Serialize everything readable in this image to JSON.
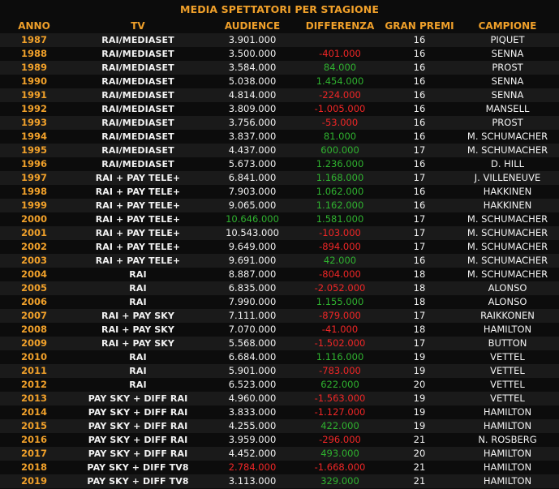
{
  "title": "MEDIA SPETTATORI PER STAGIONE",
  "colors": {
    "header": "#f0a02a",
    "year": "#f0a02a",
    "text": "#f2f2f2",
    "positive": "#2fb22f",
    "negative": "#f02626"
  },
  "chart_data": {
    "type": "table",
    "title": "MEDIA SPETTATORI PER STAGIONE",
    "columns": [
      "ANNO",
      "TV",
      "AUDIENCE",
      "DIFFERENZA",
      "GRAN PREMI",
      "CAMPIONE"
    ],
    "rows": [
      {
        "year": "1987",
        "tv": "RAI/MEDIASET",
        "audience": "3.901.000",
        "diff": "",
        "diff_sign": "none",
        "gp": "16",
        "champion": "PIQUET",
        "aud_color": "white"
      },
      {
        "year": "1988",
        "tv": "RAI/MEDIASET",
        "audience": "3.500.000",
        "diff": "-401.000",
        "diff_sign": "neg",
        "gp": "16",
        "champion": "SENNA",
        "aud_color": "white"
      },
      {
        "year": "1989",
        "tv": "RAI/MEDIASET",
        "audience": "3.584.000",
        "diff": "84.000",
        "diff_sign": "pos",
        "gp": "16",
        "champion": "PROST",
        "aud_color": "white"
      },
      {
        "year": "1990",
        "tv": "RAI/MEDIASET",
        "audience": "5.038.000",
        "diff": "1.454.000",
        "diff_sign": "pos",
        "gp": "16",
        "champion": "SENNA",
        "aud_color": "white"
      },
      {
        "year": "1991",
        "tv": "RAI/MEDIASET",
        "audience": "4.814.000",
        "diff": "-224.000",
        "diff_sign": "neg",
        "gp": "16",
        "champion": "SENNA",
        "aud_color": "white"
      },
      {
        "year": "1992",
        "tv": "RAI/MEDIASET",
        "audience": "3.809.000",
        "diff": "-1.005.000",
        "diff_sign": "neg",
        "gp": "16",
        "champion": "MANSELL",
        "aud_color": "white"
      },
      {
        "year": "1993",
        "tv": "RAI/MEDIASET",
        "audience": "3.756.000",
        "diff": "-53.000",
        "diff_sign": "neg",
        "gp": "16",
        "champion": "PROST",
        "aud_color": "white"
      },
      {
        "year": "1994",
        "tv": "RAI/MEDIASET",
        "audience": "3.837.000",
        "diff": "81.000",
        "diff_sign": "pos",
        "gp": "16",
        "champion": "M. SCHUMACHER",
        "aud_color": "white"
      },
      {
        "year": "1995",
        "tv": "RAI/MEDIASET",
        "audience": "4.437.000",
        "diff": "600.000",
        "diff_sign": "pos",
        "gp": "17",
        "champion": "M. SCHUMACHER",
        "aud_color": "white"
      },
      {
        "year": "1996",
        "tv": "RAI/MEDIASET",
        "audience": "5.673.000",
        "diff": "1.236.000",
        "diff_sign": "pos",
        "gp": "16",
        "champion": "D. HILL",
        "aud_color": "white"
      },
      {
        "year": "1997",
        "tv": "RAI + PAY TELE+",
        "audience": "6.841.000",
        "diff": "1.168.000",
        "diff_sign": "pos",
        "gp": "17",
        "champion": "J. VILLENEUVE",
        "aud_color": "white"
      },
      {
        "year": "1998",
        "tv": "RAI + PAY TELE+",
        "audience": "7.903.000",
        "diff": "1.062.000",
        "diff_sign": "pos",
        "gp": "16",
        "champion": "HAKKINEN",
        "aud_color": "white"
      },
      {
        "year": "1999",
        "tv": "RAI + PAY TELE+",
        "audience": "9.065.000",
        "diff": "1.162.000",
        "diff_sign": "pos",
        "gp": "16",
        "champion": "HAKKINEN",
        "aud_color": "white"
      },
      {
        "year": "2000",
        "tv": "RAI + PAY TELE+",
        "audience": "10.646.000",
        "diff": "1.581.000",
        "diff_sign": "pos",
        "gp": "17",
        "champion": "M. SCHUMACHER",
        "aud_color": "green"
      },
      {
        "year": "2001",
        "tv": "RAI + PAY TELE+",
        "audience": "10.543.000",
        "diff": "-103.000",
        "diff_sign": "neg",
        "gp": "17",
        "champion": "M. SCHUMACHER",
        "aud_color": "white"
      },
      {
        "year": "2002",
        "tv": "RAI + PAY TELE+",
        "audience": "9.649.000",
        "diff": "-894.000",
        "diff_sign": "neg",
        "gp": "17",
        "champion": "M. SCHUMACHER",
        "aud_color": "white"
      },
      {
        "year": "2003",
        "tv": "RAI + PAY TELE+",
        "audience": "9.691.000",
        "diff": "42.000",
        "diff_sign": "pos",
        "gp": "16",
        "champion": "M. SCHUMACHER",
        "aud_color": "white"
      },
      {
        "year": "2004",
        "tv": "RAI",
        "audience": "8.887.000",
        "diff": "-804.000",
        "diff_sign": "neg",
        "gp": "18",
        "champion": "M. SCHUMACHER",
        "aud_color": "white"
      },
      {
        "year": "2005",
        "tv": "RAI",
        "audience": "6.835.000",
        "diff": "-2.052.000",
        "diff_sign": "neg",
        "gp": "18",
        "champion": "ALONSO",
        "aud_color": "white"
      },
      {
        "year": "2006",
        "tv": "RAI",
        "audience": "7.990.000",
        "diff": "1.155.000",
        "diff_sign": "pos",
        "gp": "18",
        "champion": "ALONSO",
        "aud_color": "white"
      },
      {
        "year": "2007",
        "tv": "RAI + PAY SKY",
        "audience": "7.111.000",
        "diff": "-879.000",
        "diff_sign": "neg",
        "gp": "17",
        "champion": "RAIKKONEN",
        "aud_color": "white"
      },
      {
        "year": "2008",
        "tv": "RAI + PAY SKY",
        "audience": "7.070.000",
        "diff": "-41.000",
        "diff_sign": "neg",
        "gp": "18",
        "champion": "HAMILTON",
        "aud_color": "white"
      },
      {
        "year": "2009",
        "tv": "RAI + PAY SKY",
        "audience": "5.568.000",
        "diff": "-1.502.000",
        "diff_sign": "neg",
        "gp": "17",
        "champion": "BUTTON",
        "aud_color": "white"
      },
      {
        "year": "2010",
        "tv": "RAI",
        "audience": "6.684.000",
        "diff": "1.116.000",
        "diff_sign": "pos",
        "gp": "19",
        "champion": "VETTEL",
        "aud_color": "white"
      },
      {
        "year": "2011",
        "tv": "RAI",
        "audience": "5.901.000",
        "diff": "-783.000",
        "diff_sign": "neg",
        "gp": "19",
        "champion": "VETTEL",
        "aud_color": "white"
      },
      {
        "year": "2012",
        "tv": "RAI",
        "audience": "6.523.000",
        "diff": "622.000",
        "diff_sign": "pos",
        "gp": "20",
        "champion": "VETTEL",
        "aud_color": "white"
      },
      {
        "year": "2013",
        "tv": "PAY SKY + DIFF RAI",
        "audience": "4.960.000",
        "diff": "-1.563.000",
        "diff_sign": "neg",
        "gp": "19",
        "champion": "VETTEL",
        "aud_color": "white"
      },
      {
        "year": "2014",
        "tv": "PAY SKY + DIFF RAI",
        "audience": "3.833.000",
        "diff": "-1.127.000",
        "diff_sign": "neg",
        "gp": "19",
        "champion": "HAMILTON",
        "aud_color": "white"
      },
      {
        "year": "2015",
        "tv": "PAY SKY + DIFF RAI",
        "audience": "4.255.000",
        "diff": "422.000",
        "diff_sign": "pos",
        "gp": "19",
        "champion": "HAMILTON",
        "aud_color": "white"
      },
      {
        "year": "2016",
        "tv": "PAY SKY + DIFF RAI",
        "audience": "3.959.000",
        "diff": "-296.000",
        "diff_sign": "neg",
        "gp": "21",
        "champion": "N. ROSBERG",
        "aud_color": "white"
      },
      {
        "year": "2017",
        "tv": "PAY SKY + DIFF RAI",
        "audience": "4.452.000",
        "diff": "493.000",
        "diff_sign": "pos",
        "gp": "20",
        "champion": "HAMILTON",
        "aud_color": "white"
      },
      {
        "year": "2018",
        "tv": "PAY SKY + DIFF TV8",
        "audience": "2.784.000",
        "diff": "-1.668.000",
        "diff_sign": "neg",
        "gp": "21",
        "champion": "HAMILTON",
        "aud_color": "red"
      },
      {
        "year": "2019",
        "tv": "PAY SKY + DIFF TV8",
        "audience": "3.113.000",
        "diff": "329.000",
        "diff_sign": "pos",
        "gp": "21",
        "champion": "HAMILTON",
        "aud_color": "white"
      }
    ]
  }
}
